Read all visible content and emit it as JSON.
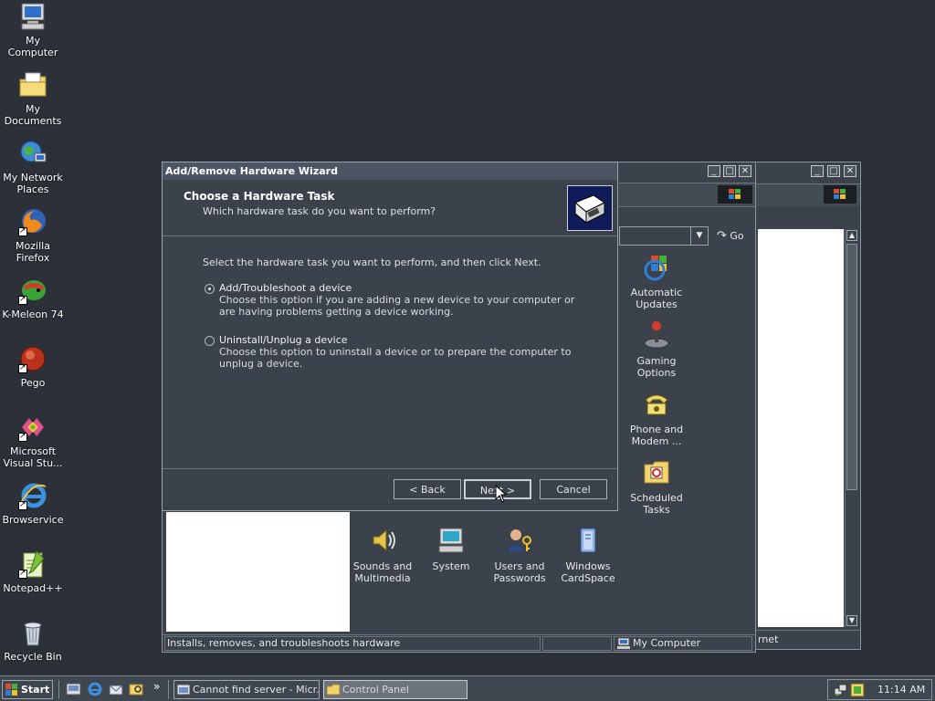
{
  "desktop_icons": [
    {
      "label": "My Computer",
      "icon": "my-computer-icon"
    },
    {
      "label": "My Documents",
      "icon": "my-documents-icon"
    },
    {
      "label": "My Network Places",
      "icon": "network-places-icon"
    },
    {
      "label": "Mozilla Firefox",
      "icon": "firefox-icon"
    },
    {
      "label": "K-Meleon 74",
      "icon": "k-meleon-icon"
    },
    {
      "label": "Pego",
      "icon": "pego-icon"
    },
    {
      "label": "Microsoft Visual Stu...",
      "icon": "visual-studio-icon"
    },
    {
      "label": "Browservice",
      "icon": "browservice-icon"
    },
    {
      "label": "Notepad++",
      "icon": "notepad-plus-icon"
    },
    {
      "label": "Recycle Bin",
      "icon": "recycle-bin-icon"
    }
  ],
  "wizard": {
    "title": "Add/Remove Hardware Wizard",
    "heading": "Choose a Hardware Task",
    "subheading": "Which hardware task do you want to perform?",
    "instruction": "Select the hardware task you want to perform, and then click Next.",
    "options": [
      {
        "label": "Add/Troubleshoot a device",
        "desc": "Choose this option if you are adding a new device to your computer or are having problems getting a device working.",
        "selected": true
      },
      {
        "label": "Uninstall/Unplug a device",
        "desc": "Choose this option to uninstall a device or to prepare the computer to unplug a device.",
        "selected": false
      }
    ],
    "back": "< Back",
    "next": "Next >",
    "cancel": "Cancel"
  },
  "control_panel": {
    "go_label": "Go",
    "icons_right": [
      {
        "label": "Automatic Updates",
        "icon": "automatic-updates-icon"
      },
      {
        "label": "Gaming Options",
        "icon": "gaming-options-icon"
      },
      {
        "label": "Phone and Modem ...",
        "icon": "phone-modem-icon"
      },
      {
        "label": "Scheduled Tasks",
        "icon": "scheduled-tasks-icon"
      }
    ],
    "icons_bottom": [
      {
        "label": "Sounds and Multimedia",
        "icon": "sounds-multimedia-icon"
      },
      {
        "label": "System",
        "icon": "system-icon"
      },
      {
        "label": "Users and Passwords",
        "icon": "users-passwords-icon"
      },
      {
        "label": "Windows CardSpace",
        "icon": "cardspace-icon"
      }
    ],
    "status_text": "Installs, removes, and troubleshoots hardware",
    "status_location": "My Computer"
  },
  "back_window": {
    "status_text": "rnet"
  },
  "taskbar": {
    "start_label": "Start",
    "tasks": [
      {
        "label": "Cannot find server - Micr...",
        "active": false
      },
      {
        "label": "Control Panel",
        "active": true
      }
    ],
    "clock": "11:14 AM"
  }
}
